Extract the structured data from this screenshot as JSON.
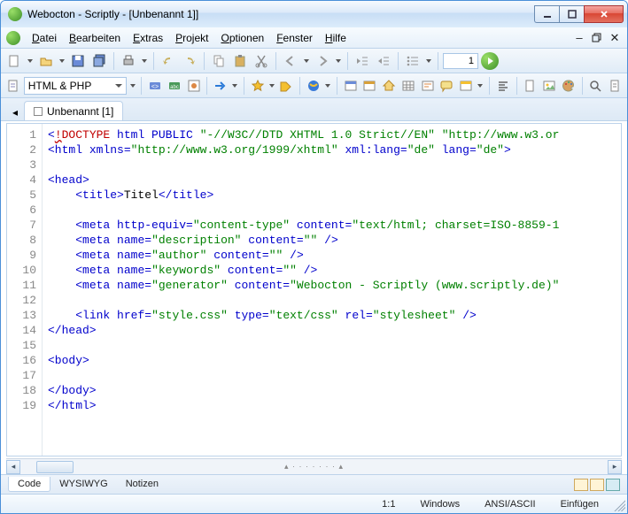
{
  "window": {
    "title": "Webocton - Scriptly - [Unbenannt 1]]"
  },
  "menu": {
    "items": [
      {
        "label": "Datei",
        "key": "D"
      },
      {
        "label": "Bearbeiten",
        "key": "B"
      },
      {
        "label": "Extras",
        "key": "E"
      },
      {
        "label": "Projekt",
        "key": "P"
      },
      {
        "label": "Optionen",
        "key": "O"
      },
      {
        "label": "Fenster",
        "key": "F"
      },
      {
        "label": "Hilfe",
        "key": "H"
      }
    ]
  },
  "toolbar1": {
    "goto_value": "1",
    "icons": [
      "new",
      "open",
      "save",
      "save-all",
      "print",
      "undo",
      "redo",
      "copy",
      "paste",
      "cut",
      "back",
      "forward",
      "outdent",
      "indent",
      "bullets"
    ]
  },
  "toolbar2": {
    "language": "HTML & PHP",
    "icons": [
      "tag",
      "attr",
      "css",
      "arrow-right",
      "star",
      "tags",
      "globe-ie",
      "window",
      "window2",
      "home",
      "grid",
      "style",
      "comment",
      "window3",
      "align-left",
      "doc",
      "image",
      "palette",
      "search",
      "doc2"
    ]
  },
  "tabs": {
    "active": "Unbenannt [1]"
  },
  "code": {
    "lines": [
      {
        "n": 1,
        "html": "<span class='t-blue'>&lt;</span><span class='t-err t-red'>!</span><span class='t-red'>DOCTYPE</span> <span class='t-blue'>html PUBLIC</span> <span class='t-green'>\"-//W3C//DTD XHTML 1.0 Strict//EN\"</span> <span class='t-green'>\"http://www.w3.or</span>"
      },
      {
        "n": 2,
        "html": "<span class='t-blue'>&lt;html</span> <span class='t-blue'>xmlns=</span><span class='t-green'>\"http://www.w3.org/1999/xhtml\"</span> <span class='t-blue'>xml:lang=</span><span class='t-green'>\"de\"</span> <span class='t-blue'>lang=</span><span class='t-green'>\"de\"</span><span class='t-blue'>&gt;</span>"
      },
      {
        "n": 3,
        "html": ""
      },
      {
        "n": 4,
        "html": "<span class='t-blue'>&lt;head&gt;</span>"
      },
      {
        "n": 5,
        "html": "    <span class='t-blue'>&lt;title&gt;</span>Titel<span class='t-blue'>&lt;/title&gt;</span>"
      },
      {
        "n": 6,
        "html": ""
      },
      {
        "n": 7,
        "html": "    <span class='t-blue'>&lt;meta</span> <span class='t-blue'>http-equiv=</span><span class='t-green'>\"content-type\"</span> <span class='t-blue'>content=</span><span class='t-green'>\"text/html; charset=ISO-8859-1</span>"
      },
      {
        "n": 8,
        "html": "    <span class='t-blue'>&lt;meta</span> <span class='t-blue'>name=</span><span class='t-green'>\"description\"</span> <span class='t-blue'>content=</span><span class='t-green'>\"\"</span> <span class='t-blue'>/&gt;</span>"
      },
      {
        "n": 9,
        "html": "    <span class='t-blue'>&lt;meta</span> <span class='t-blue'>name=</span><span class='t-green'>\"author\"</span> <span class='t-blue'>content=</span><span class='t-green'>\"\"</span> <span class='t-blue'>/&gt;</span>"
      },
      {
        "n": 10,
        "html": "    <span class='t-blue'>&lt;meta</span> <span class='t-blue'>name=</span><span class='t-green'>\"keywords\"</span> <span class='t-blue'>content=</span><span class='t-green'>\"\"</span> <span class='t-blue'>/&gt;</span>"
      },
      {
        "n": 11,
        "html": "    <span class='t-blue'>&lt;meta</span> <span class='t-blue'>name=</span><span class='t-green'>\"generator\"</span> <span class='t-blue'>content=</span><span class='t-green'>\"Webocton - Scriptly (www.scriptly.de)\"</span>"
      },
      {
        "n": 12,
        "html": ""
      },
      {
        "n": 13,
        "html": "    <span class='t-blue'>&lt;link</span> <span class='t-blue'>href=</span><span class='t-green'>\"style.css\"</span> <span class='t-blue'>type=</span><span class='t-green'>\"text/css\"</span> <span class='t-blue'>rel=</span><span class='t-green'>\"stylesheet\"</span> <span class='t-blue'>/&gt;</span>"
      },
      {
        "n": 14,
        "html": "<span class='t-blue'>&lt;/head&gt;</span>"
      },
      {
        "n": 15,
        "html": ""
      },
      {
        "n": 16,
        "html": "<span class='t-blue'>&lt;body&gt;</span>"
      },
      {
        "n": 17,
        "html": ""
      },
      {
        "n": 18,
        "html": "<span class='t-blue'>&lt;/body&gt;</span>"
      },
      {
        "n": 19,
        "html": "<span class='t-blue'>&lt;/html&gt;</span>"
      }
    ]
  },
  "bottom_tabs": {
    "items": [
      "Code",
      "WYSIWYG",
      "Notizen"
    ],
    "active": "Code"
  },
  "status": {
    "pos": "1:1",
    "os": "Windows",
    "encoding": "ANSI/ASCII",
    "mode": "Einfügen"
  }
}
